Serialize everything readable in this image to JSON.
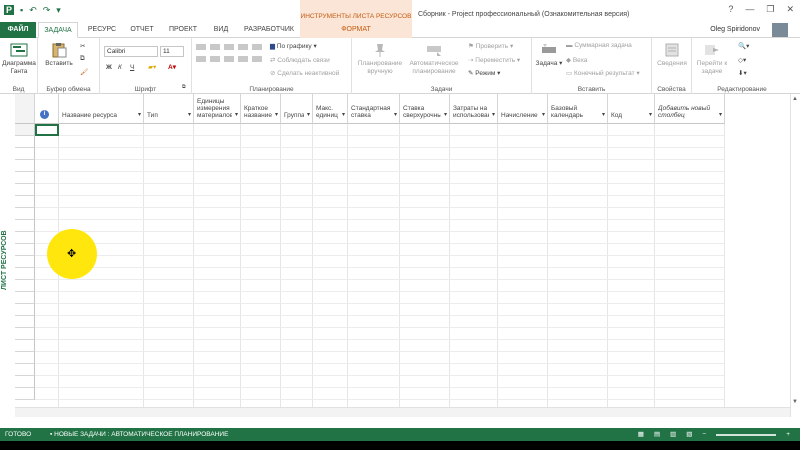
{
  "window": {
    "context_tab_title": "ИНСТРУМЕНТЫ ЛИСТА РЕСУРСОВ",
    "title": "Сборник - Project профессиональный (Ознакомительная версия)",
    "user": "Oleg Spiridonov",
    "controls": [
      "?",
      "—",
      "❐",
      "✕"
    ]
  },
  "tabs": [
    "ФАЙЛ",
    "ЗАДАЧА",
    "РЕСУРС",
    "ОТЧЕТ",
    "ПРОЕКТ",
    "ВИД",
    "РАЗРАБОТЧИК",
    "ФОРМАТ"
  ],
  "active_tab": "ЗАДАЧА",
  "ribbon": {
    "view": {
      "gantt_label": "Диаграмма Ганта",
      "group": "Вид"
    },
    "clipboard": {
      "paste": "Вставить",
      "group": "Буфер обмена"
    },
    "font": {
      "font_name": "Calibri",
      "font_size": "11",
      "bold": "Ж",
      "italic": "К",
      "underline": "Ч",
      "group": "Шрифт"
    },
    "schedule": {
      "on_track": "По графику",
      "respect_links": "Соблюдать связи",
      "inactivate": "Сделать неактивной",
      "group": "Планирование"
    },
    "tasks": {
      "manual": "Планирование вручную",
      "auto": "Автоматическое планирование",
      "inspect": "Проверить",
      "move": "Переместить",
      "mode": "Режим",
      "group": "Задачи"
    },
    "insert": {
      "task": "Задача",
      "summary": "Суммарная задача",
      "milestone": "Веха",
      "deliverable": "Конечный результат",
      "group": "Вставить"
    },
    "properties": {
      "info": "Сведения",
      "group": "Свойства"
    },
    "editing": {
      "scroll": "Перейти к задаче",
      "group": "Редактирование"
    }
  },
  "sheet": {
    "side_label": "ЛИСТ РЕСУРСОВ",
    "columns": [
      "Название ресурса",
      "Тип",
      "Единицы измерения материалов",
      "Краткое название",
      "Группа",
      "Макс. единиц",
      "Стандартная ставка",
      "Ставка сверхурочных",
      "Затраты на использование",
      "Начисление",
      "Базовый календарь",
      "Код",
      "Добавить новый столбец"
    ]
  },
  "status": {
    "ready": "ГОТОВО",
    "new_tasks": "НОВЫЕ ЗАДАЧИ : АВТОМАТИЧЕСКОЕ ПЛАНИРОВАНИЕ"
  }
}
